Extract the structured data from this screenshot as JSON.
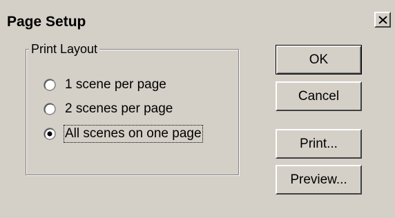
{
  "window": {
    "title": "Page Setup",
    "close_glyph": "close-icon"
  },
  "print_layout": {
    "group_label": "Print Layout",
    "options": [
      {
        "label": "1 scene per page",
        "selected": false
      },
      {
        "label": "2 scenes per page",
        "selected": false
      },
      {
        "label": "All scenes on one page",
        "selected": true
      }
    ]
  },
  "buttons": {
    "ok": "OK",
    "cancel": "Cancel",
    "print": "Print...",
    "preview": "Preview..."
  },
  "colors": {
    "face": "#d4d0c8",
    "highlight": "#ffffff",
    "shadow": "#808080",
    "dark_shadow": "#404040"
  }
}
